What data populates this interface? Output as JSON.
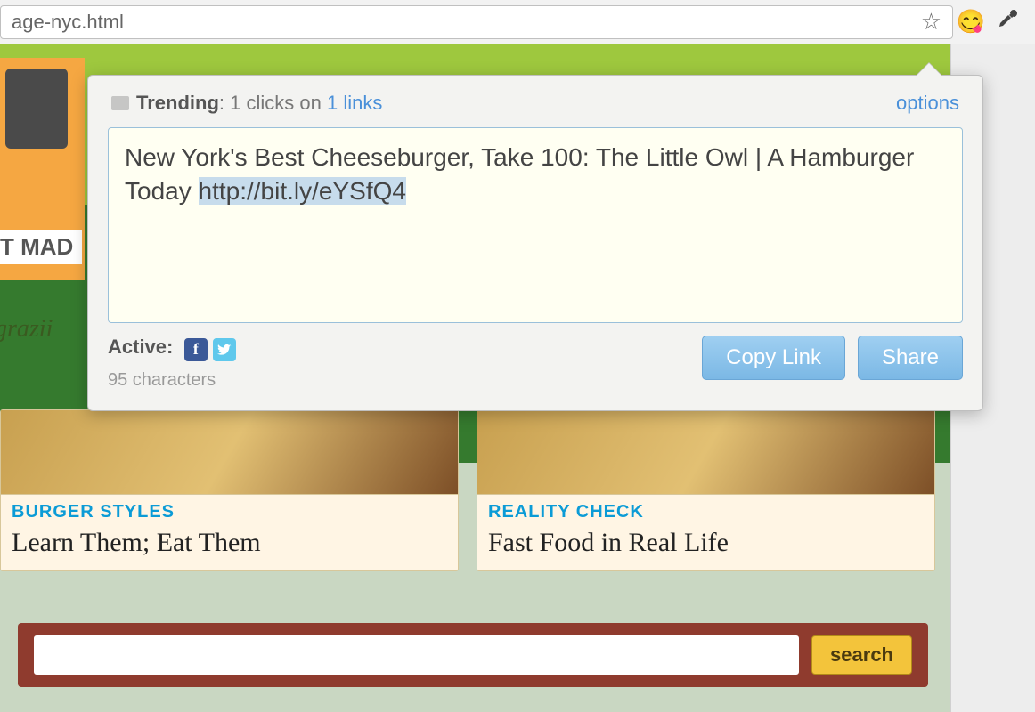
{
  "addressbar": {
    "url_fragment": "age-nyc.html"
  },
  "popup": {
    "trending_label": "Trending",
    "trending_clicks_text": "1 clicks on",
    "trending_links_text": "1 links",
    "options_label": "options",
    "compose_text_prefix": "New York's Best Cheeseburger, Take 100: The Little Owl | A Hamburger Today ",
    "compose_url": "http://bit.ly/eYSfQ4",
    "active_label": "Active:",
    "char_count_text": "95 characters",
    "copy_link_label": "Copy Link",
    "share_label": "Share"
  },
  "background": {
    "mad_label": "T MAD",
    "grazin_label": "grazii",
    "cards": [
      {
        "category": "BURGER STYLES",
        "title": "Learn Them; Eat Them"
      },
      {
        "category": "REALITY CHECK",
        "title": "Fast Food in Real Life"
      }
    ],
    "search_button_label": "search"
  }
}
